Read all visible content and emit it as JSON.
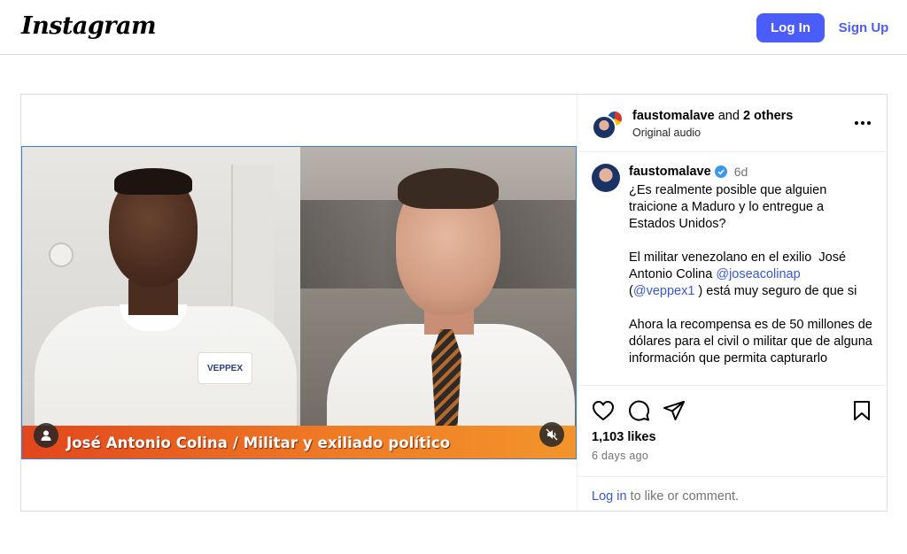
{
  "header": {
    "logo": "Instagram",
    "login_label": "Log In",
    "signup_label": "Sign Up"
  },
  "video": {
    "lower_third": "José Antonio Colina / Militar y exiliado político",
    "patch_text": "VEPPEX"
  },
  "post": {
    "header_user": "faustomalave",
    "header_and": " and ",
    "header_others": "2 others",
    "header_sub": "Original audio",
    "caption_user": "faustomalave",
    "caption_time": "6d",
    "caption_line1": "¿Es realmente posible que alguien traicione a Maduro y lo entregue a Estados Unidos?",
    "caption_line2_a": "El militar venezolano en el exilio  José Antonio Colina ",
    "caption_mention1": "@joseacolinap",
    "caption_line2_b": "(",
    "caption_mention2": "@veppex1",
    "caption_line2_c": " ) está muy seguro de que si",
    "caption_line3": "Ahora la recompensa es de 50 millones de dólares para el civil o militar que de alguna información que permita capturarlo",
    "likes": "1,103 likes",
    "ago": "6 days ago",
    "login_link": "Log in",
    "login_rest": " to like or comment."
  },
  "colors": {
    "accent": "#4a5df9",
    "link": "#3658d8",
    "border": "#dbdbdb",
    "banner": "#ef7a25"
  },
  "icons": [
    "heart-icon",
    "comment-icon",
    "share-icon",
    "bookmark-icon",
    "more-icon",
    "mute-icon",
    "user-icon",
    "verified-icon"
  ]
}
